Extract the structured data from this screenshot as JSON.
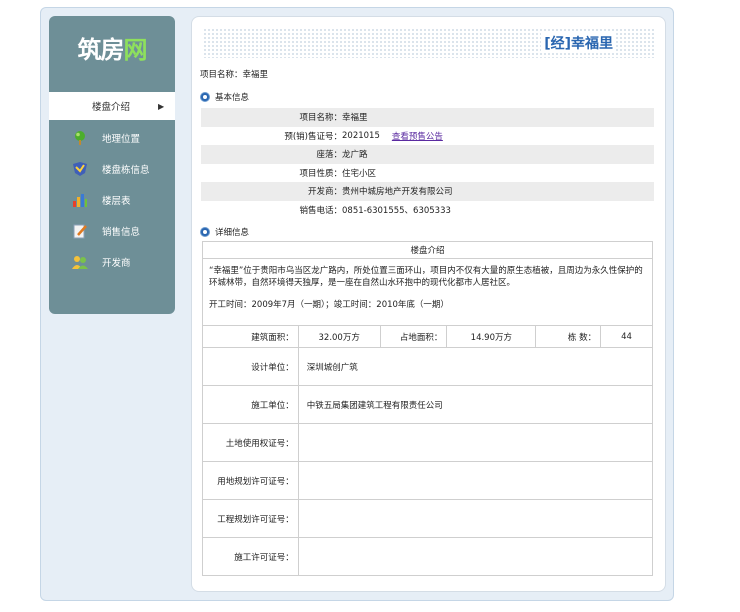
{
  "logo": {
    "part1": "筑房",
    "part2": "网"
  },
  "sidebar": {
    "active": {
      "label": "楼盘介绍",
      "arrow": "▶"
    },
    "items": [
      {
        "label": "地理位置",
        "icon": "globe-icon"
      },
      {
        "label": "楼盘栋信息",
        "icon": "badge-icon"
      },
      {
        "label": "楼层表",
        "icon": "chart-icon"
      },
      {
        "label": "销售信息",
        "icon": "document-edit-icon"
      },
      {
        "label": "开发商",
        "icon": "people-icon"
      }
    ]
  },
  "header": {
    "title": "[经]幸福里"
  },
  "project_name_line": "项目名称：幸福里",
  "basic": {
    "section_label": "基本信息",
    "rows": [
      {
        "key": "项目名称：",
        "value": "幸福里"
      },
      {
        "key": "预(销)售证号：",
        "value": "2021015",
        "link": "查看预售公告"
      },
      {
        "key": "座落：",
        "value": "龙广路"
      },
      {
        "key": "项目性质：",
        "value": "住宅小区"
      },
      {
        "key": "开发商：",
        "value": "贵州中城房地产开发有限公司"
      },
      {
        "key": "销售电话：",
        "value": "0851-6301555、6305333"
      }
    ]
  },
  "detail": {
    "section_label": "详细信息",
    "table_title": "楼盘介绍",
    "description": "“幸福里”位于贵阳市乌当区龙广路内，所处位置三面环山，项目内不仅有大量的原生态植被，且周边为永久性保护的环城林带，自然环境得天独厚，是一座在自然山水环抱中的现代化都市人居社区。",
    "dates": "开工时间：2009年7月（一期）；竣工时间：2010年底（一期）",
    "area_label": "建筑面积：",
    "area_value": "32.00万方",
    "land_label": "占地面积：",
    "land_value": "14.90万方",
    "count_label": "栋 数：",
    "count_value": "44",
    "rows": [
      {
        "key": "设计单位：",
        "value": "深圳城创广筑"
      },
      {
        "key": "施工单位：",
        "value": "中铁五局集团建筑工程有限责任公司"
      },
      {
        "key": "土地使用权证号：",
        "value": ""
      },
      {
        "key": "用地规划许可证号：",
        "value": ""
      },
      {
        "key": "工程规划许可证号：",
        "value": ""
      },
      {
        "key": "施工许可证号：",
        "value": ""
      }
    ]
  }
}
